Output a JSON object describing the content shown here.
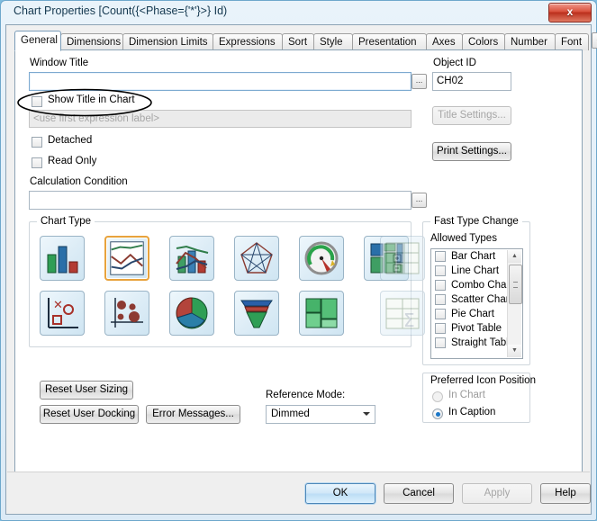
{
  "window": {
    "title": "Chart Properties [Count({<Phase={'*'}>} Id)",
    "close_label": "x"
  },
  "tabs": [
    {
      "label": "General",
      "active": true
    },
    {
      "label": "Dimensions",
      "active": false
    },
    {
      "label": "Dimension Limits",
      "active": false
    },
    {
      "label": "Expressions",
      "active": false
    },
    {
      "label": "Sort",
      "active": false
    },
    {
      "label": "Style",
      "active": false
    },
    {
      "label": "Presentation",
      "active": false
    },
    {
      "label": "Axes",
      "active": false
    },
    {
      "label": "Colors",
      "active": false
    },
    {
      "label": "Number",
      "active": false
    },
    {
      "label": "Font",
      "active": false
    }
  ],
  "tab_nav": {
    "prev": "◄",
    "next": "►"
  },
  "general": {
    "window_title_label": "Window Title",
    "window_title_value": "",
    "window_title_browse": "...",
    "show_title_in_chart_label": "Show Title in Chart",
    "show_title_in_chart_checked": false,
    "chart_title_placeholder": "<use first expression label>",
    "detached_label": "Detached",
    "detached_checked": false,
    "read_only_label": "Read Only",
    "read_only_checked": false,
    "calculation_condition_label": "Calculation Condition",
    "calculation_condition_value": "",
    "calculation_condition_browse": "...",
    "object_id_label": "Object ID",
    "object_id_value": "CH02",
    "title_settings_label": "Title Settings...",
    "print_settings_label": "Print Settings..."
  },
  "chart_type": {
    "group_label": "Chart Type",
    "tiles": [
      {
        "name": "bar-chart",
        "selected": false,
        "disabled": false
      },
      {
        "name": "line-chart",
        "selected": true,
        "disabled": false
      },
      {
        "name": "combo-chart",
        "selected": false,
        "disabled": false
      },
      {
        "name": "radar-chart",
        "selected": false,
        "disabled": false
      },
      {
        "name": "gauge-chart",
        "selected": false,
        "disabled": false
      },
      {
        "name": "grid-chart",
        "selected": false,
        "disabled": false
      },
      {
        "name": "pivot-table",
        "selected": false,
        "disabled": true
      },
      {
        "name": "scatter-chart",
        "selected": false,
        "disabled": false
      },
      {
        "name": "bubble-chart",
        "selected": false,
        "disabled": false
      },
      {
        "name": "pie-chart",
        "selected": false,
        "disabled": false
      },
      {
        "name": "funnel-chart",
        "selected": false,
        "disabled": false
      },
      {
        "name": "block-chart",
        "selected": false,
        "disabled": false
      },
      {
        "name": "straight-table",
        "selected": false,
        "disabled": true
      }
    ]
  },
  "fast_type_change": {
    "group_label": "Fast Type Change",
    "allowed_types_label": "Allowed Types",
    "items": [
      {
        "label": "Bar Chart",
        "checked": false
      },
      {
        "label": "Line Chart",
        "checked": false
      },
      {
        "label": "Combo Chart",
        "checked": false
      },
      {
        "label": "Scatter Chart",
        "checked": false
      },
      {
        "label": "Pie Chart",
        "checked": false
      },
      {
        "label": "Pivot Table",
        "checked": false
      },
      {
        "label": "Straight Table",
        "checked": false
      }
    ],
    "scroll_up": "▲",
    "scroll_down": "▼"
  },
  "icon_position": {
    "label": "Preferred Icon Position",
    "options": [
      {
        "label": "In Chart",
        "selected": false,
        "disabled": true
      },
      {
        "label": "In Caption",
        "selected": true,
        "disabled": false
      }
    ]
  },
  "bottom_controls": {
    "reset_user_sizing": "Reset User Sizing",
    "reset_user_docking": "Reset User Docking",
    "error_messages": "Error Messages...",
    "reference_mode_label": "Reference Mode:",
    "reference_mode_value": "Dimmed"
  },
  "footer": {
    "ok": "OK",
    "cancel": "Cancel",
    "apply": "Apply",
    "help": "Help"
  },
  "colors": {
    "selection_orange": "#e8a33d",
    "radio_blue": "#1b77c8",
    "close_red": "#d9503c"
  }
}
